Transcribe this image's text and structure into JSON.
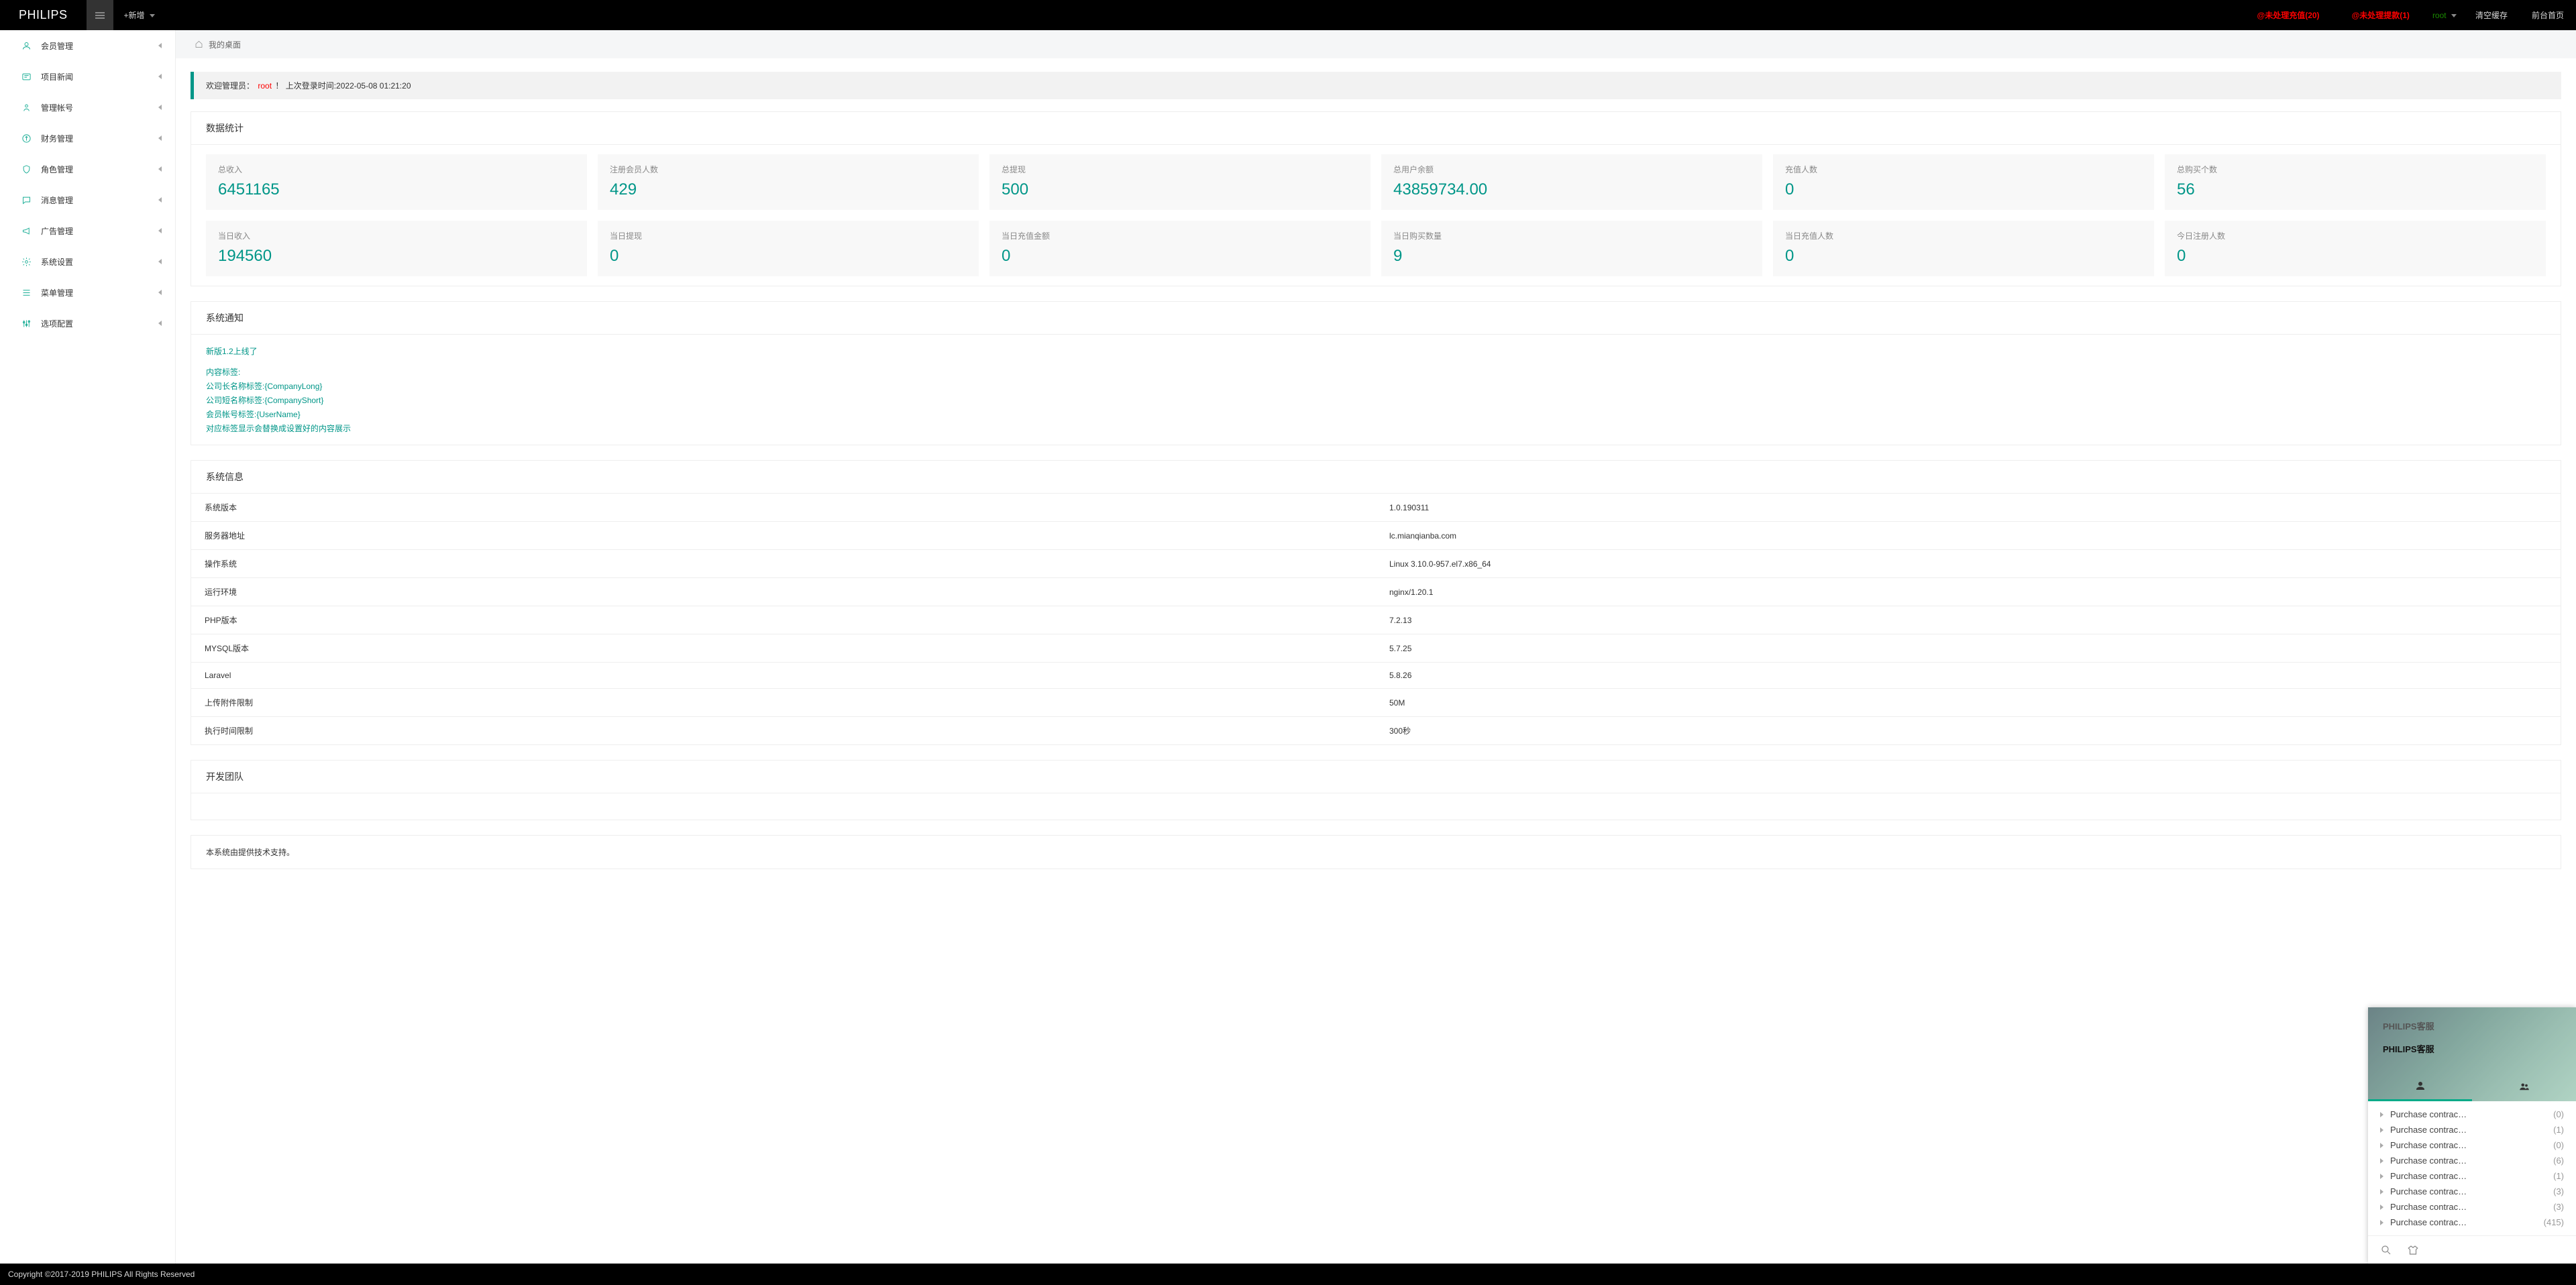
{
  "brand": "PHILIPS",
  "add_new_label": "+新增",
  "pending_recharge": "@未处理充值(20)",
  "pending_withdraw": "@未处理提款(1)",
  "user_name": "root",
  "top_links": {
    "clear_cache": "清空缓存",
    "front_home": "前台首页"
  },
  "sidebar": {
    "items": [
      {
        "label": "会员管理"
      },
      {
        "label": "项目新闻"
      },
      {
        "label": "管理帐号"
      },
      {
        "label": "财务管理"
      },
      {
        "label": "角色管理"
      },
      {
        "label": "消息管理"
      },
      {
        "label": "广告管理"
      },
      {
        "label": "系统设置"
      },
      {
        "label": "菜单管理"
      },
      {
        "label": "选项配置"
      }
    ]
  },
  "breadcrumb": "我的桌面",
  "welcome": {
    "prefix": "欢迎管理员：",
    "name": "root",
    "last_login": "！ 上次登录时间:2022-05-08 01:21:20"
  },
  "stats_title": "数据统计",
  "stats_row1": [
    {
      "label": "总收入",
      "value": "6451165"
    },
    {
      "label": "注册会员人数",
      "value": "429"
    },
    {
      "label": "总提现",
      "value": "500"
    },
    {
      "label": "总用户余额",
      "value": "43859734.00"
    },
    {
      "label": "充值人数",
      "value": "0"
    },
    {
      "label": "总购买个数",
      "value": "56"
    }
  ],
  "stats_row2": [
    {
      "label": "当日收入",
      "value": "194560"
    },
    {
      "label": "当日提现",
      "value": "0"
    },
    {
      "label": "当日充值金额",
      "value": "0"
    },
    {
      "label": "当日购买数量",
      "value": "9"
    },
    {
      "label": "当日充值人数",
      "value": "0"
    },
    {
      "label": "今日注册人数",
      "value": "0"
    }
  ],
  "notice_title": "系统通知",
  "notices": [
    "新版1.2上线了",
    "内容标签:",
    "公司长名称标签:{CompanyLong}",
    "公司短名称标签:{CompanyShort}",
    "会员帐号标签:{UserName}",
    "对应标签显示会替换成设置好的内容展示"
  ],
  "sysinfo_title": "系统信息",
  "sysinfo": [
    {
      "k": "系统版本",
      "v": "1.0.190311"
    },
    {
      "k": "服务器地址",
      "v": "lc.mianqianba.com"
    },
    {
      "k": "操作系统",
      "v": "Linux 3.10.0-957.el7.x86_64"
    },
    {
      "k": "运行环境",
      "v": "nginx/1.20.1"
    },
    {
      "k": "PHP版本",
      "v": "7.2.13"
    },
    {
      "k": "MYSQL版本",
      "v": "5.7.25"
    },
    {
      "k": "Laravel",
      "v": "5.8.26"
    },
    {
      "k": "上传附件限制",
      "v": "50M"
    },
    {
      "k": "执行时间限制",
      "v": "300秒"
    }
  ],
  "devteam_title": "开发团队",
  "support_text": "本系统由提供技术支持。",
  "footer": "Copyright ©2017-2019 PHILIPS All Rights Reserved",
  "chat": {
    "title1": "PHILIPS客服",
    "title2": "PHILIPS客服",
    "items": [
      {
        "name": "Purchase contrac…",
        "count": "(0)"
      },
      {
        "name": "Purchase contrac…",
        "count": "(1)"
      },
      {
        "name": "Purchase contrac…",
        "count": "(0)"
      },
      {
        "name": "Purchase contrac…",
        "count": "(6)"
      },
      {
        "name": "Purchase contrac…",
        "count": "(1)"
      },
      {
        "name": "Purchase contrac…",
        "count": "(3)"
      },
      {
        "name": "Purchase contrac…",
        "count": "(3)"
      },
      {
        "name": "Purchase contrac…",
        "count": "(415)"
      }
    ]
  }
}
